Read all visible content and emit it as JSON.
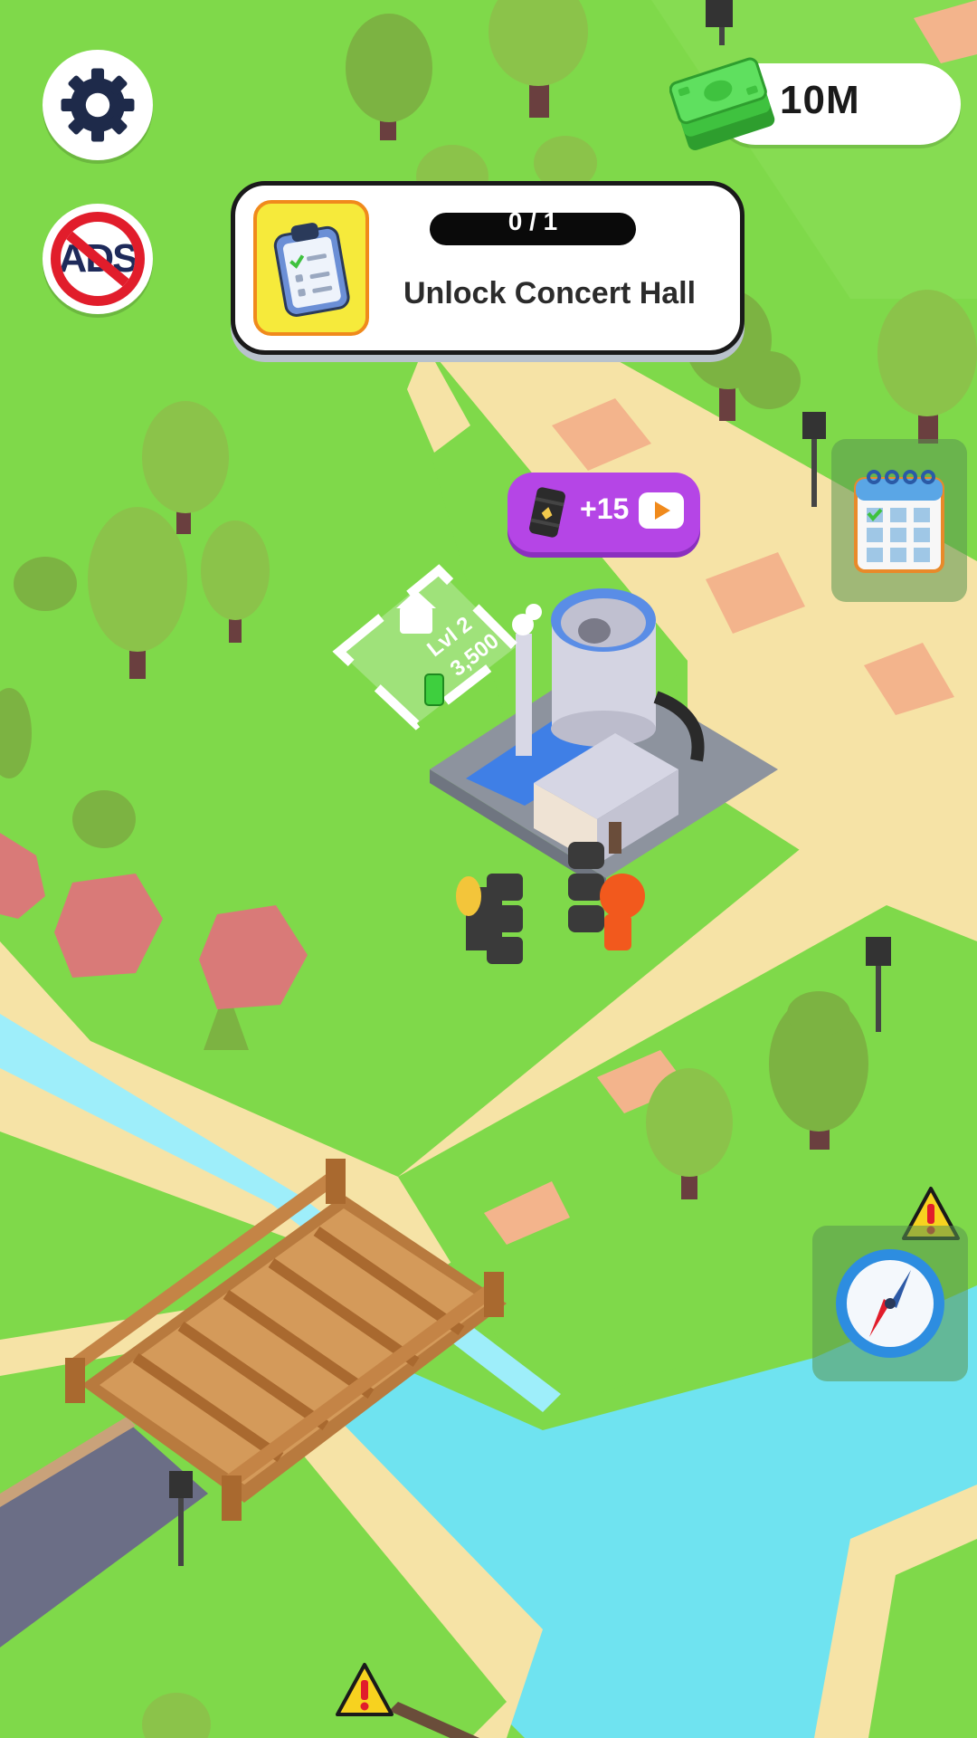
{
  "hud": {
    "cash": "10M",
    "settings_icon": "gear-icon",
    "no_ads_label": "ADS"
  },
  "quest": {
    "progress_text": "0 / 1",
    "progress_current": 0,
    "progress_total": 1,
    "title": "Unlock Concert Hall",
    "icon": "clipboard-checklist-icon"
  },
  "reward": {
    "label": "+15",
    "icon": "oil-barrel-icon",
    "action_icon": "play-video-icon"
  },
  "upgrade": {
    "level": "Lvl 2",
    "cost": "3,500"
  },
  "side_buttons": {
    "calendar_icon": "calendar-icon",
    "compass_icon": "compass-icon",
    "warning_icon": "warning-icon"
  },
  "colors": {
    "grass": "#7fd94a",
    "path": "#f6e3a6",
    "water": "#6fe3f0",
    "accent_purple": "#b545e6",
    "quest_yellow": "#f6ea3b"
  }
}
